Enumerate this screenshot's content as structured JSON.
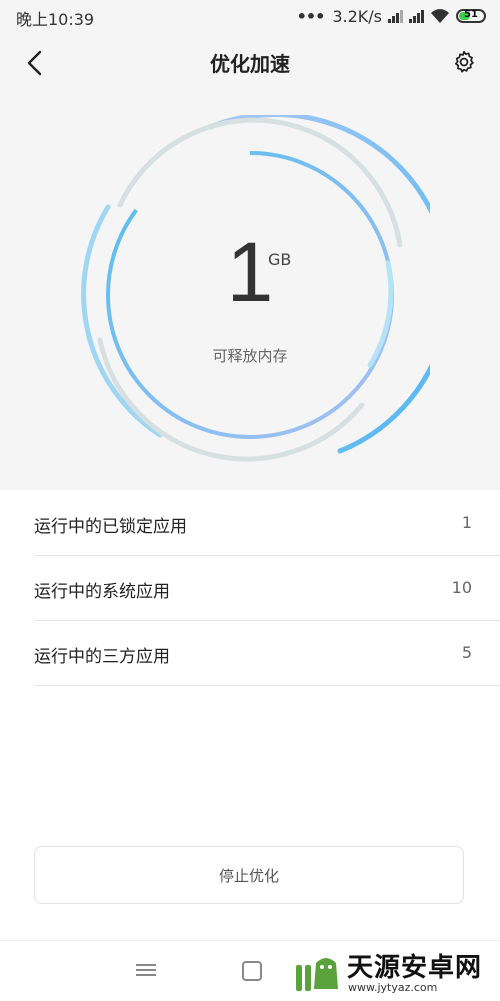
{
  "status_bar": {
    "time": "晚上10:39",
    "net_speed": "3.2K/s",
    "battery_level": "51",
    "battery_fraction": 0.51
  },
  "header": {
    "title": "优化加速",
    "back_icon": "chevron-left-icon",
    "settings_icon": "gear-icon"
  },
  "memory": {
    "value": "1",
    "unit": "GB",
    "caption": "可释放内存"
  },
  "list": [
    {
      "label": "运行中的已锁定应用",
      "count": "1"
    },
    {
      "label": "运行中的系统应用",
      "count": "10"
    },
    {
      "label": "运行中的三方应用",
      "count": "5"
    }
  ],
  "stop_button": {
    "label": "停止优化"
  },
  "nav": {
    "menu_icon": "menu-icon",
    "home_icon": "square-icon"
  },
  "watermark": {
    "title": "天源安卓网",
    "url": "www.jytyaz.com"
  },
  "colors": {
    "ring_blue": "#4fb8f0",
    "ring_light": "#a9c6f5",
    "ring_gray": "#d7e0e0",
    "battery_green": "#3ccf4e",
    "watermark_green": "#5aa33c"
  }
}
